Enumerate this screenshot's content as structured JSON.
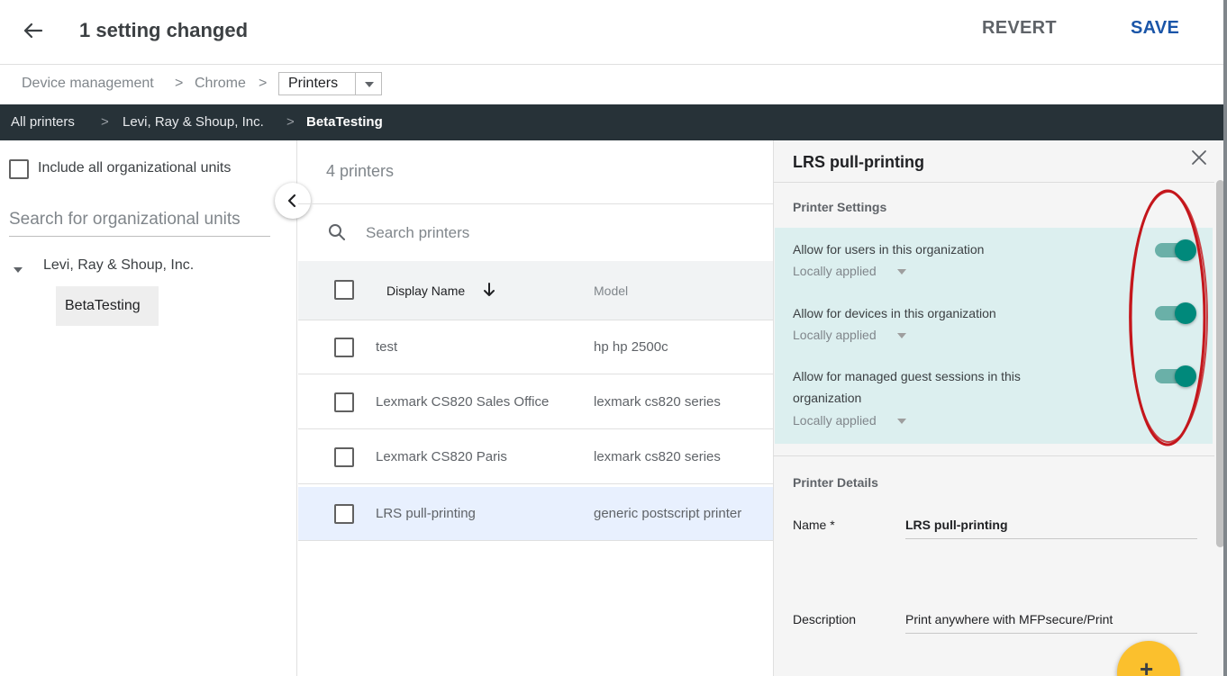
{
  "header": {
    "title": "1 setting changed",
    "revert_label": "REVERT",
    "save_label": "SAVE"
  },
  "breadcrumb": {
    "items": [
      "Device management",
      "Chrome"
    ],
    "separator": ">",
    "current_select": "Printers"
  },
  "org_path": {
    "items": [
      "All printers",
      "Levi, Ray & Shoup, Inc.",
      "BetaTesting"
    ],
    "separator": ">"
  },
  "left_panel": {
    "include_all_label": "Include all organizational units",
    "search_placeholder": "Search for organizational units",
    "tree_root": "Levi, Ray & Shoup, Inc.",
    "tree_child": "BetaTesting"
  },
  "printer_list": {
    "count_label": "4 printers",
    "search_placeholder": "Search printers",
    "columns": {
      "display_name": "Display Name",
      "model": "Model"
    },
    "rows": [
      {
        "name": "test",
        "model": "hp hp 2500c",
        "selected": false
      },
      {
        "name": "Lexmark CS820 Sales Office",
        "model": "lexmark cs820 series",
        "selected": false
      },
      {
        "name": "Lexmark CS820 Paris",
        "model": "lexmark cs820 series",
        "selected": false
      },
      {
        "name": "LRS pull-printing",
        "model": "generic postscript printer",
        "selected": true
      }
    ]
  },
  "detail_panel": {
    "title": "LRS pull-printing",
    "settings_section_title": "Printer Settings",
    "settings": [
      {
        "label": "Allow for users in this organization",
        "applied": "Locally applied",
        "enabled": true
      },
      {
        "label": "Allow for devices in this organization",
        "applied": "Locally applied",
        "enabled": true
      },
      {
        "label": "Allow for managed guest sessions in this organization",
        "applied": "Locally applied",
        "enabled": true
      }
    ],
    "details_section_title": "Printer Details",
    "fields": {
      "name_label": "Name *",
      "name_value": "LRS pull-printing",
      "description_label": "Description",
      "description_value": "Print anywhere with MFPsecure/Print"
    },
    "fab_label": "+"
  },
  "colors": {
    "save_accent": "#1a55a8",
    "org_bar": "#273238",
    "toggle_on": "#00897b",
    "settings_bg": "#dcefef",
    "selected_row": "#e8f0fe",
    "fab": "#fbc02d",
    "annotation_oval": "#c4161c"
  },
  "icons": {
    "back": "arrow-left-icon",
    "close": "close-icon",
    "search": "search-icon",
    "sort": "arrow-down-icon",
    "collapse": "chevron-left-icon",
    "add": "plus-icon"
  }
}
